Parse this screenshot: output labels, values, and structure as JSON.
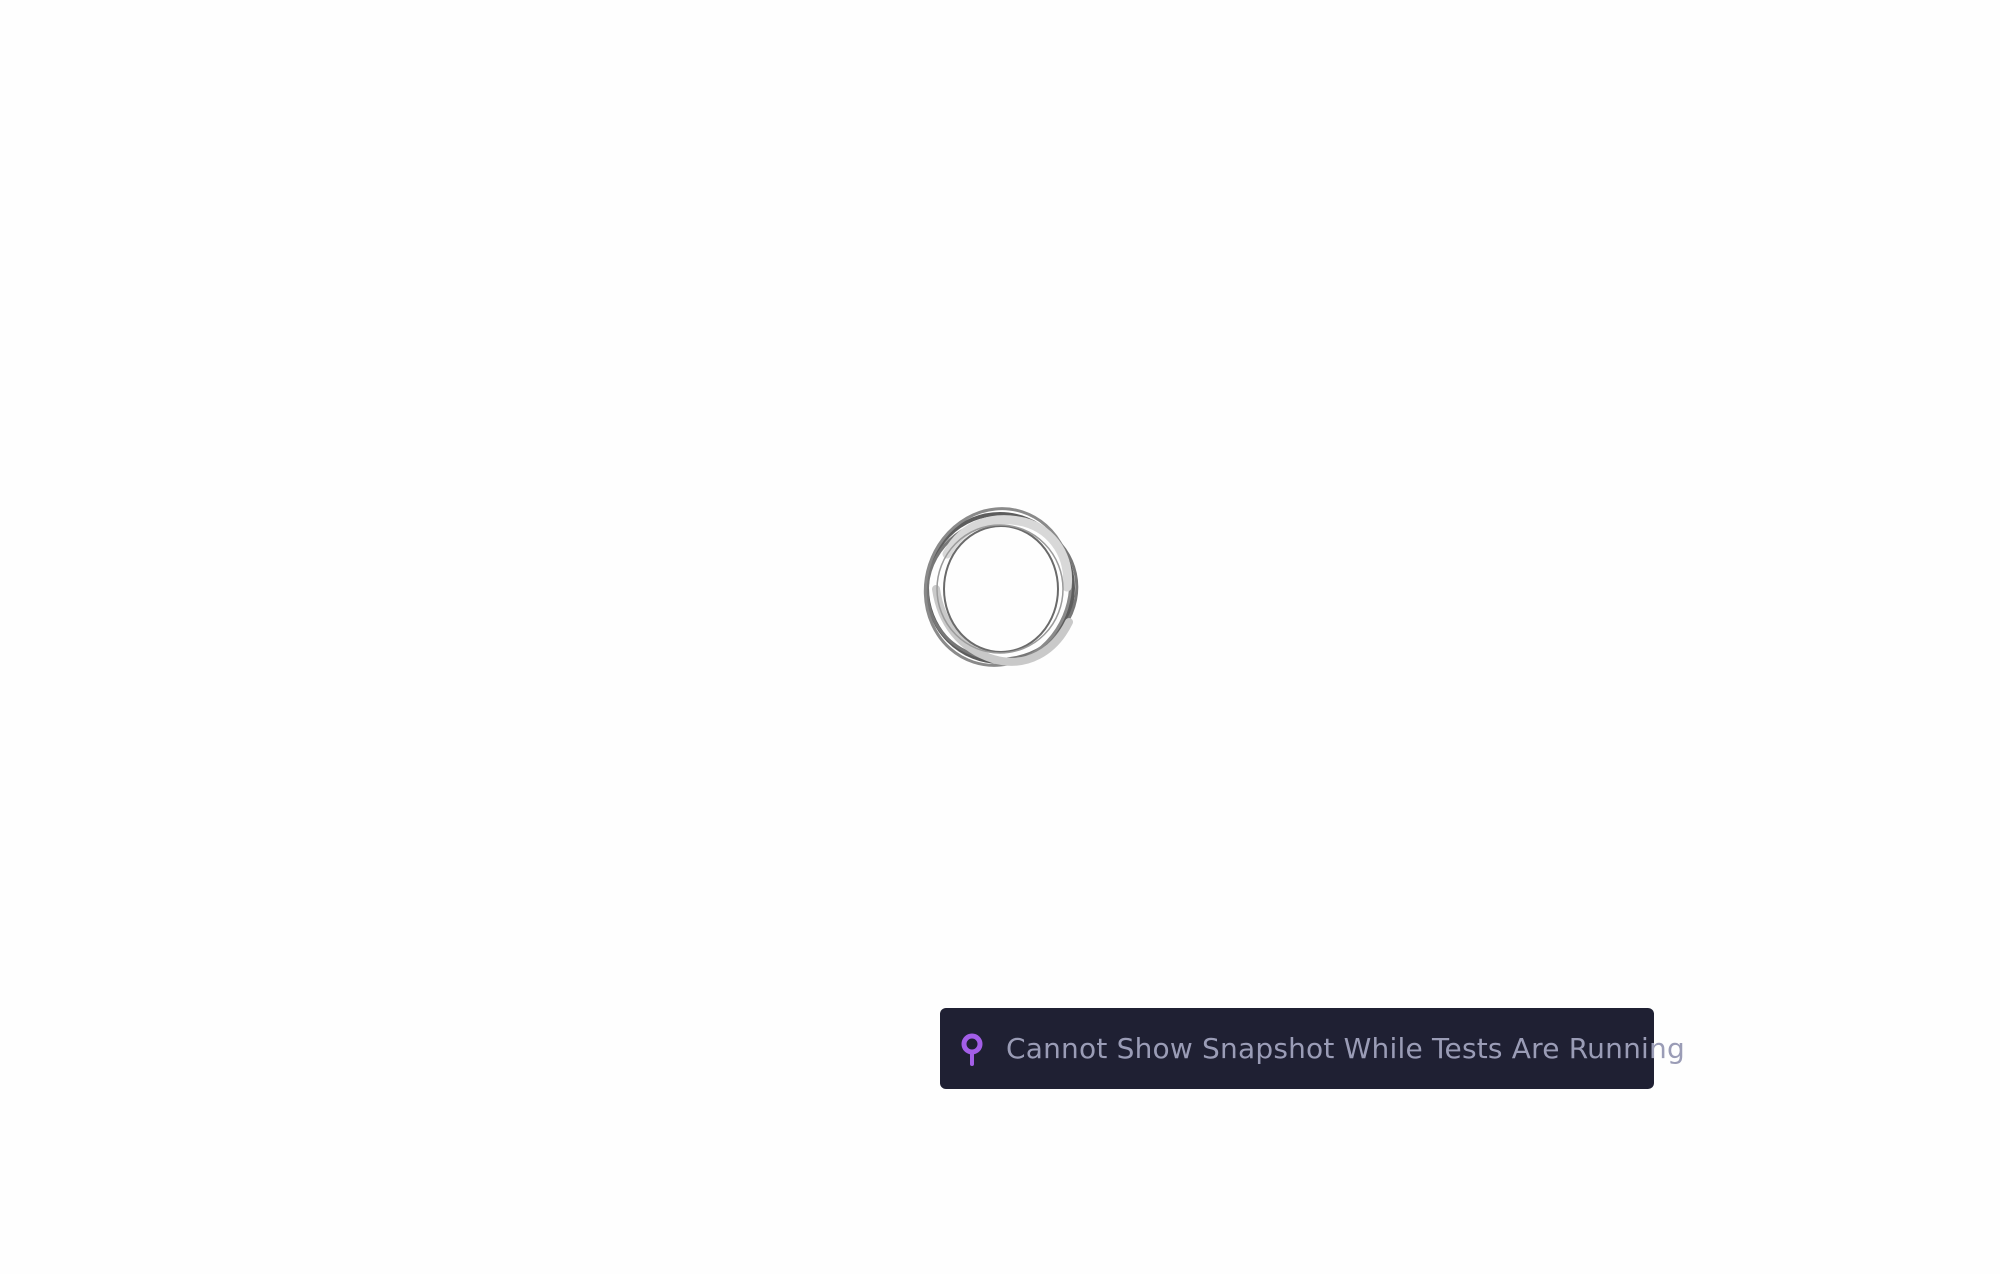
{
  "toast": {
    "message": "Cannot Show Snapshot While Tests Are Running",
    "icon": "pin-icon",
    "background_color": "#1f2033",
    "text_color": "#9a9cb6",
    "icon_color": "#a35ee8"
  },
  "loading": {
    "icon": "loading-spinner-icon"
  }
}
